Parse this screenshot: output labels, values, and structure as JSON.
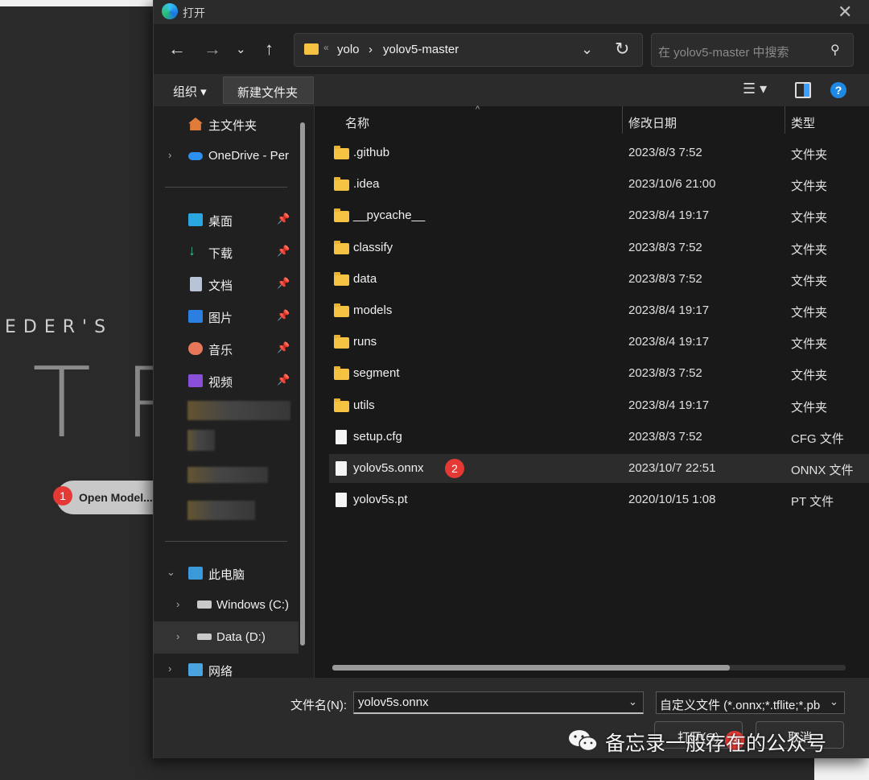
{
  "background_app": {
    "brand_partial": "EDER'S",
    "logo_partial": "TR",
    "open_model_button": "Open Model...",
    "badge_open_model": "1"
  },
  "dialog": {
    "title": "打开",
    "address": {
      "crumbs": [
        "yolo",
        "yolov5-master"
      ],
      "separator": "›",
      "overflow": "«"
    },
    "search_placeholder": "在 yolov5-master 中搜索",
    "toolbar": {
      "organize": "组织 ▾",
      "new_folder": "新建文件夹"
    },
    "sidebar": {
      "home": "主文件夹",
      "onedrive": "OneDrive - Per",
      "quick": [
        "桌面",
        "下载",
        "文档",
        "图片",
        "音乐",
        "视频"
      ],
      "this_pc": "此电脑",
      "drives": [
        "Windows (C:)",
        "Data (D:)"
      ],
      "network": "网络"
    },
    "columns": {
      "name": "名称",
      "date": "修改日期",
      "type": "类型"
    },
    "files": [
      {
        "name": ".github",
        "date": "2023/8/3 7:52",
        "type": "文件夹",
        "kind": "folder"
      },
      {
        "name": ".idea",
        "date": "2023/10/6 21:00",
        "type": "文件夹",
        "kind": "folder"
      },
      {
        "name": "__pycache__",
        "date": "2023/8/4 19:17",
        "type": "文件夹",
        "kind": "folder"
      },
      {
        "name": "classify",
        "date": "2023/8/3 7:52",
        "type": "文件夹",
        "kind": "folder"
      },
      {
        "name": "data",
        "date": "2023/8/3 7:52",
        "type": "文件夹",
        "kind": "folder"
      },
      {
        "name": "models",
        "date": "2023/8/4 19:17",
        "type": "文件夹",
        "kind": "folder"
      },
      {
        "name": "runs",
        "date": "2023/8/4 19:17",
        "type": "文件夹",
        "kind": "folder"
      },
      {
        "name": "segment",
        "date": "2023/8/3 7:52",
        "type": "文件夹",
        "kind": "folder"
      },
      {
        "name": "utils",
        "date": "2023/8/4 19:17",
        "type": "文件夹",
        "kind": "folder"
      },
      {
        "name": "setup.cfg",
        "date": "2023/8/3 7:52",
        "type": "CFG 文件",
        "kind": "file"
      },
      {
        "name": "yolov5s.onnx",
        "date": "2023/10/7 22:51",
        "type": "ONNX 文件",
        "kind": "file",
        "selected": true
      },
      {
        "name": "yolov5s.pt",
        "date": "2020/10/15 1:08",
        "type": "PT 文件",
        "kind": "file"
      }
    ],
    "badge_selected_file": "2",
    "filename_label": "文件名(N):",
    "filename_value": "yolov5s.onnx",
    "filter_value": "自定义文件 (*.onnx;*.tflite;*.pb",
    "open_button": "打开(O)",
    "cancel_button": "取消",
    "badge_open_button": "3"
  },
  "watermark": "备忘录一般存在的公众号",
  "colors": {
    "accent": "#1e88e5",
    "folder": "#f5c242",
    "badge": "#e53935",
    "dialog_bg": "#202020"
  }
}
